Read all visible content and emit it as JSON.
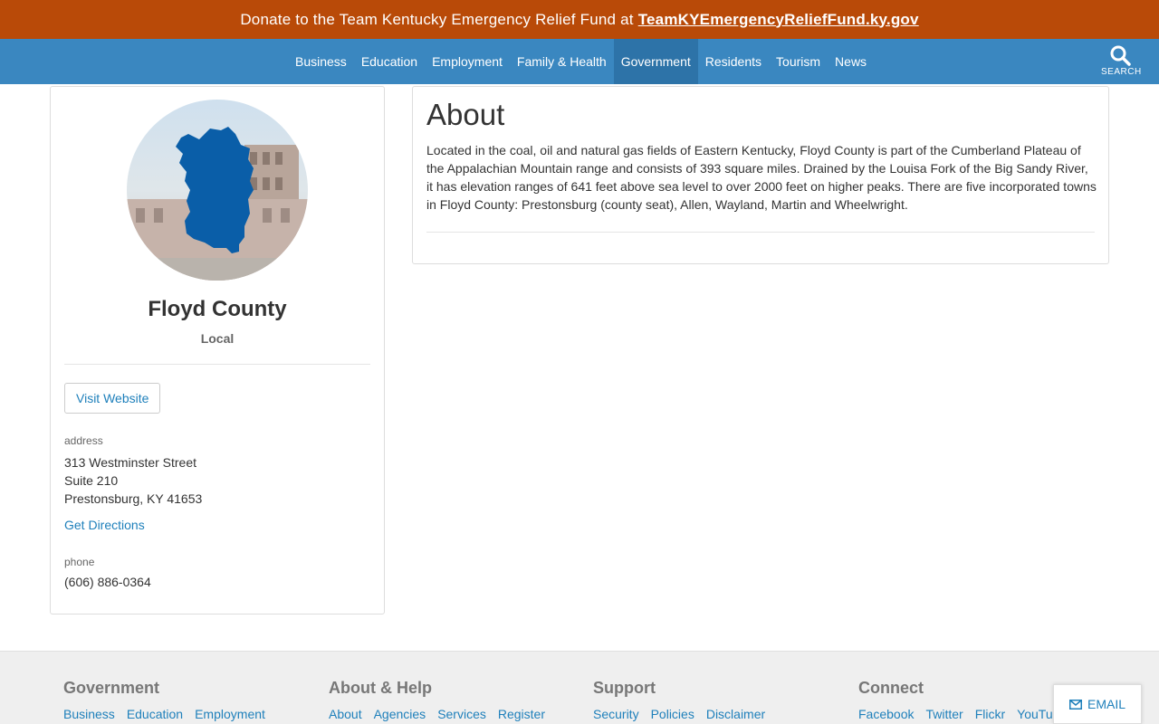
{
  "banner": {
    "text": "Donate to the Team Kentucky Emergency Relief Fund at",
    "link": "TeamKYEmergencyReliefFund.ky.gov"
  },
  "nav": {
    "items": [
      "Business",
      "Education",
      "Employment",
      "Family & Health",
      "Government",
      "Residents",
      "Tourism",
      "News"
    ],
    "active": "Government",
    "search_label": "SEARCH"
  },
  "profile": {
    "name": "Floyd County",
    "type": "Local",
    "visit_label": "Visit Website",
    "address_label": "address",
    "address_lines": [
      "313 Westminster Street",
      "Suite 210",
      "Prestonsburg, KY 41653"
    ],
    "directions_label": "Get Directions",
    "phone_label": "phone",
    "phone": "(606) 886-0364"
  },
  "about": {
    "title": "About",
    "text": "Located in the coal, oil and natural gas fields of Eastern Kentucky, Floyd County is part of the Cumberland Plateau of the Appalachian Mountain range and consists of 393 square miles. Drained by the Louisa Fork of the Big Sandy River, it has elevation ranges of 641 feet above sea level to over 2000 feet on higher peaks. There are five incorporated towns in Floyd County: Prestonsburg (county seat), Allen, Wayland, Martin and Wheelwright."
  },
  "footer": {
    "columns": [
      {
        "title": "Government",
        "links": [
          "Business",
          "Education",
          "Employment"
        ]
      },
      {
        "title": "About & Help",
        "links": [
          "About",
          "Agencies",
          "Services",
          "Register"
        ]
      },
      {
        "title": "Support",
        "links": [
          "Security",
          "Policies",
          "Disclaimer"
        ]
      },
      {
        "title": "Connect",
        "links": [
          "Facebook",
          "Twitter",
          "Flickr",
          "YouTube"
        ]
      }
    ]
  },
  "email_label": "EMAIL",
  "colors": {
    "banner": "#b94a08",
    "nav": "#3a87c0",
    "nav_active": "#2d73a8",
    "link": "#1f80bb",
    "county_map": "#0a5ea8"
  },
  "icons": [
    "search-icon",
    "envelope-icon",
    "county-map-icon"
  ]
}
